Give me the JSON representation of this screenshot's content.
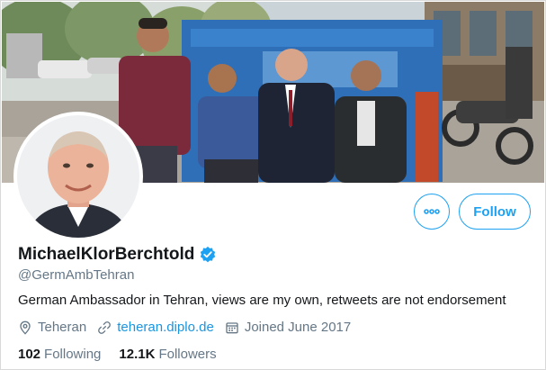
{
  "profile": {
    "display_name": "MichaelKlorBerchtold",
    "verified": true,
    "handle": "@GermAmbTehran",
    "bio": "German Ambassador in Tehran, views are my own, retweets are not endorsement",
    "location": "Teheran",
    "website": "teheran.diplo.de",
    "joined": "Joined June 2017",
    "following_count": "102",
    "following_label": "Following",
    "followers_count": "12.1K",
    "followers_label": "Followers"
  },
  "actions": {
    "follow_label": "Follow"
  },
  "icons": {
    "location": "location-pin-icon",
    "link": "link-icon",
    "calendar": "calendar-icon",
    "more": "more-dots-icon",
    "verified": "verified-badge-icon"
  },
  "colors": {
    "accent": "#1da1f2",
    "link": "#1b95e0",
    "secondary_text": "#657786",
    "primary_text": "#14171a"
  }
}
